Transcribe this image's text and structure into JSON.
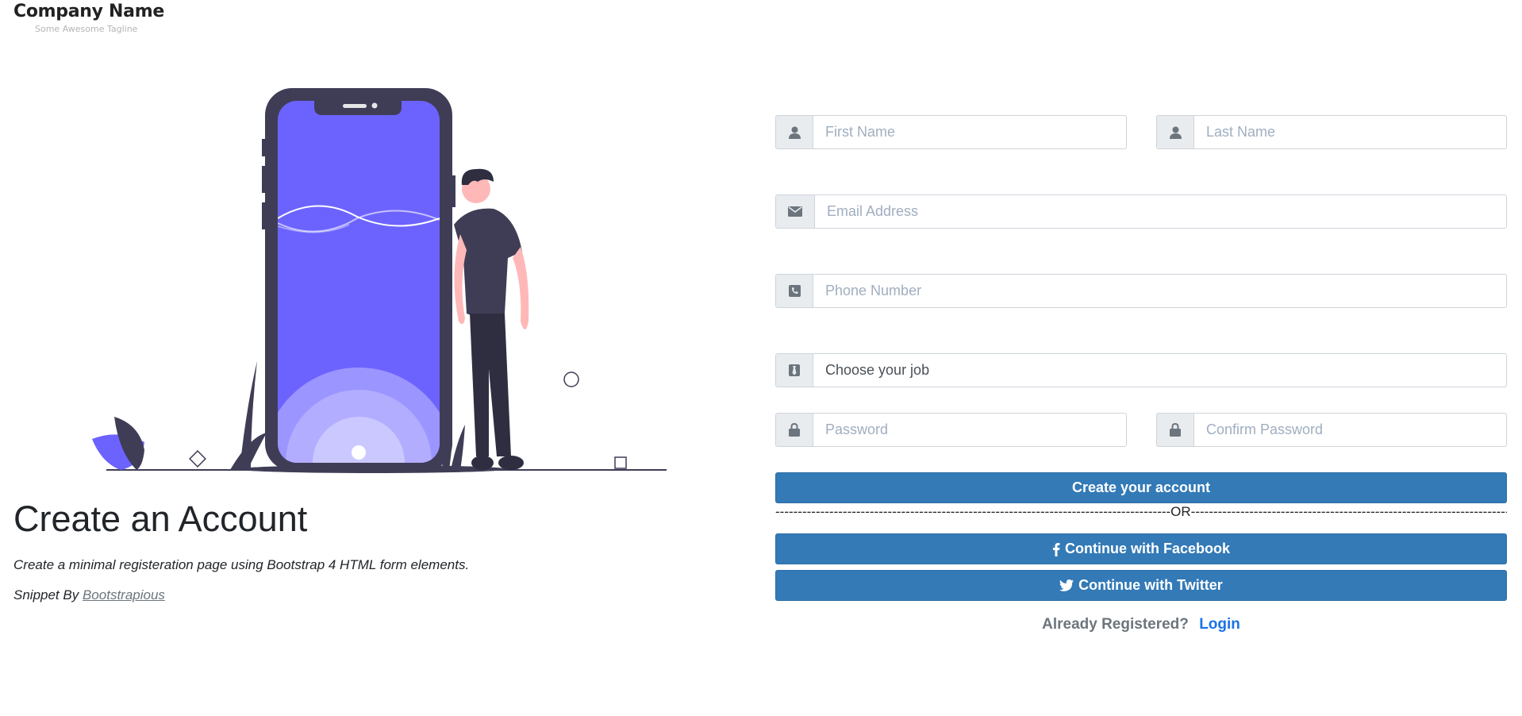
{
  "brand": {
    "name": "Company Name",
    "tagline": "Some Awesome Tagline"
  },
  "hero": {
    "title": "Create an Account",
    "description": "Create a minimal registeration page using Bootstrap 4 HTML form elements.",
    "credit_prefix": "Snippet By",
    "credit_link": "Bootstrapious"
  },
  "form": {
    "first_name": {
      "placeholder": "First Name",
      "icon": "user-icon"
    },
    "last_name": {
      "placeholder": "Last Name",
      "icon": "user-icon"
    },
    "email": {
      "placeholder": "Email Address",
      "icon": "envelope-icon"
    },
    "phone": {
      "placeholder": "Phone Number",
      "icon": "phone-icon"
    },
    "job": {
      "value": "Choose your job",
      "icon": "tie-icon"
    },
    "password": {
      "placeholder": "Password",
      "icon": "lock-icon"
    },
    "confirm_password": {
      "placeholder": "Confirm Password",
      "icon": "lock-icon"
    },
    "submit_label": "Create your account",
    "divider": "----------------------------------------------------------------------------------------OR----------------------------------------------------------------------------------------",
    "facebook_label": "Continue with Facebook",
    "twitter_label": "Continue with Twitter",
    "already_registered": "Already Registered?",
    "login_link": "Login"
  },
  "colors": {
    "primary_button": "#337ab7",
    "illustration_accent": "#6c63ff",
    "illustration_dark": "#3f3d56",
    "login_link": "#1a73e8"
  }
}
